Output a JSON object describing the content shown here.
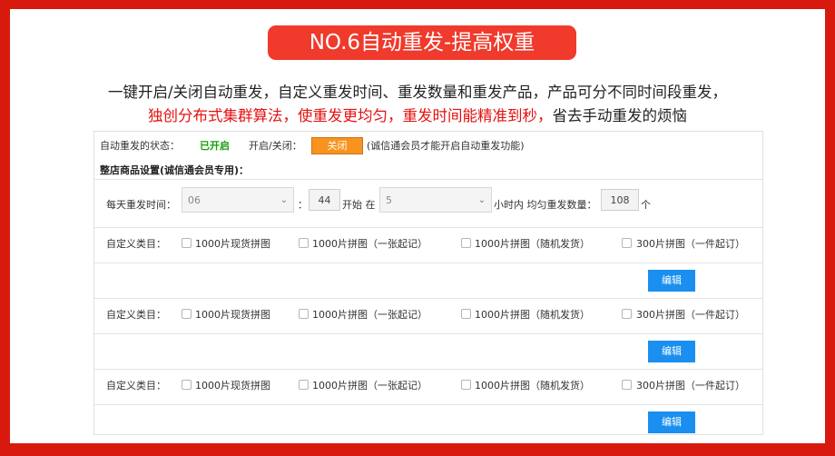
{
  "title": "NO.6自动重发-提高权重",
  "description": {
    "line1": "一键开启/关闭自动重发，自定义重发时间、重发数量和重发产品，产品可分不同时间段重发，",
    "line2_red": "独创分布式集群算法，使重发更均匀，重发时间能精准到秒，",
    "line2_black": "省去手动重发的烦恼"
  },
  "status": {
    "label": "自动重发的状态：",
    "value": "已开启",
    "toggle_label": "开启/关闭：",
    "toggle_button": "关闭",
    "note": "(诚信通会员才能开启自动重发功能)"
  },
  "section_title": "整店商品设置(诚信通会员专用)：",
  "schedule": {
    "daily_label": "每天重发时间：",
    "hour_value": "06",
    "colon": "：",
    "minute_value": "44",
    "start_text": "开始 在",
    "duration_value": "5",
    "within_text": "小时内 均匀重发数量：",
    "count_value": "108",
    "unit": "个"
  },
  "category_label": "自定义类目：",
  "categories": [
    "1000片现货拼图",
    "1000片拼图（一张起记）",
    "1000片拼图（随机发货）",
    "300片拼图（一件起订）"
  ],
  "edit_button": "编辑",
  "colors": {
    "background": "#d71a0d",
    "badge": "#ef3a2c",
    "toggle": "#f7931e",
    "edit": "#1a8ff0",
    "status": "#1aa00a",
    "emphasis": "#e60f0f"
  }
}
